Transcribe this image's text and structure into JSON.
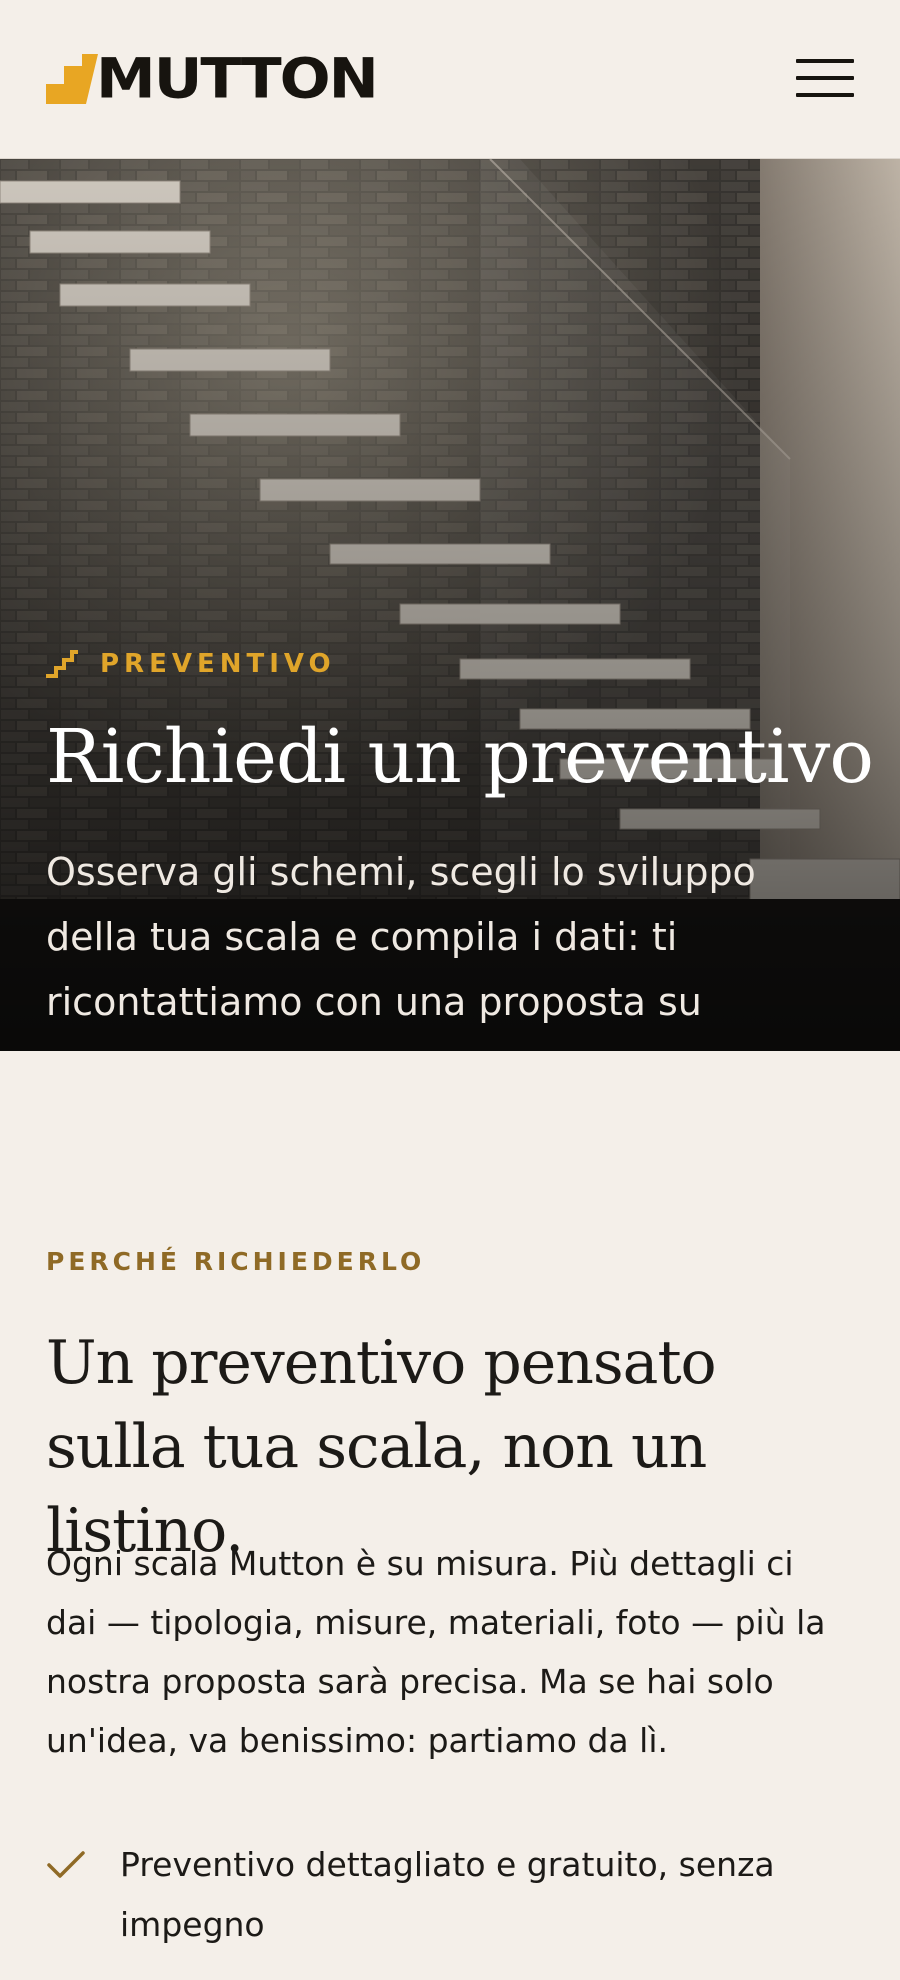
{
  "header": {
    "brand": "MUTTON",
    "logo_icon": "stair-step-icon",
    "menu_icon": "hamburger-icon",
    "accent": "#e8a623"
  },
  "hero": {
    "eyebrow": "PREVENTIVO",
    "eyebrow_icon": "stair-icon",
    "title": "Richiedi un preventivo",
    "text": "Osserva gli schemi, scegli lo sviluppo della tua scala e compila i dati: ti ricontattiamo con una proposta su misura.",
    "eyebrow_color": "#e0a52a"
  },
  "section": {
    "eyebrow": "PERCHÉ RICHIEDERLO",
    "title": "Un preventivo pensato sulla tua scala, non un listino.",
    "body": "Ogni scala Mutton è su misura. Più dettagli ci dai — tipologia, misure, materiali, foto — più la nostra proposta sarà precisa. Ma se hai solo un'idea, va benissimo: partiamo da lì.",
    "benefits": [
      {
        "icon": "check-icon",
        "text": "Preventivo dettagliato e gratuito, senza impegno"
      }
    ],
    "eyebrow_color": "#8f6a26"
  }
}
